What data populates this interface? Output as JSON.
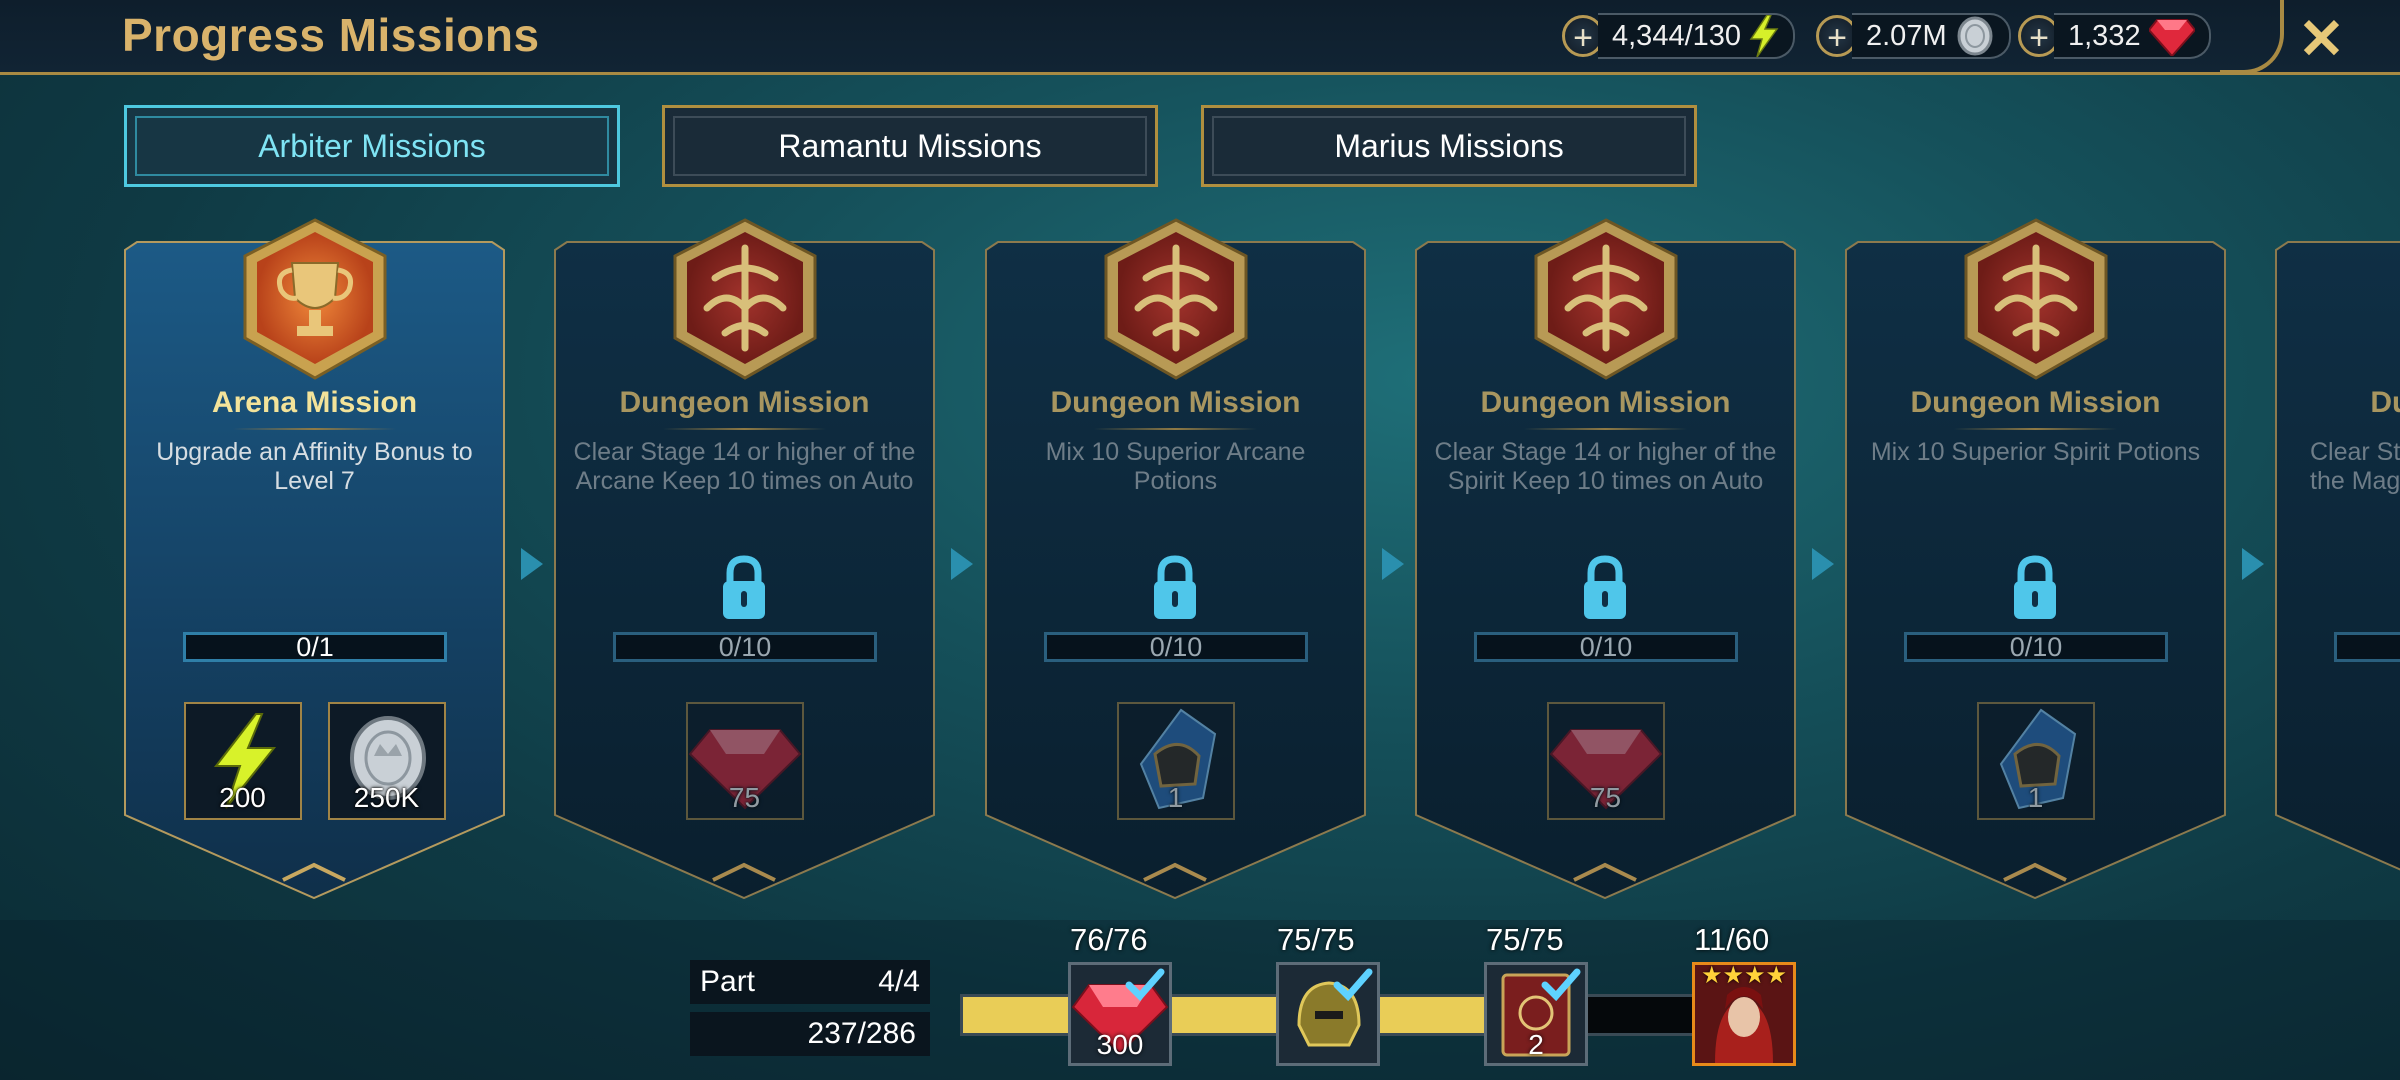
{
  "header": {
    "title": "Progress Missions",
    "close_label": "✕"
  },
  "resources": [
    {
      "value": "4,344/130",
      "icon": "energy-icon"
    },
    {
      "value": "2.07M",
      "icon": "silver-coin-icon"
    },
    {
      "value": "1,332",
      "icon": "ruby-gem-icon"
    }
  ],
  "tabs": [
    {
      "label": "Arbiter Missions",
      "active": true
    },
    {
      "label": "Ramantu Missions",
      "active": false
    },
    {
      "label": "Marius Missions",
      "active": false
    }
  ],
  "missions": [
    {
      "title": "Arena Mission",
      "desc": "Upgrade an Affinity Bonus to Level 7",
      "progress": "0/1",
      "locked": false,
      "rewards": [
        {
          "icon": "energy-icon",
          "amount": "200"
        },
        {
          "icon": "silver-coin-icon",
          "amount": "250K"
        }
      ]
    },
    {
      "title": "Dungeon Mission",
      "desc": "Clear Stage 14 or higher of the Arcane Keep 10 times on Auto",
      "progress": "0/10",
      "locked": true,
      "rewards": [
        {
          "icon": "ruby-gem-icon",
          "amount": "75"
        }
      ]
    },
    {
      "title": "Dungeon Mission",
      "desc": "Mix 10 Superior Arcane Potions",
      "progress": "0/10",
      "locked": true,
      "rewards": [
        {
          "icon": "helmet-shard-icon",
          "amount": "1"
        }
      ]
    },
    {
      "title": "Dungeon Mission",
      "desc": "Clear Stage 14 or higher of the Spirit Keep 10 times on Auto",
      "progress": "0/10",
      "locked": true,
      "rewards": [
        {
          "icon": "ruby-gem-icon",
          "amount": "75"
        }
      ]
    },
    {
      "title": "Dungeon Mission",
      "desc": "Mix 10 Superior Spirit Potions",
      "progress": "0/10",
      "locked": true,
      "rewards": [
        {
          "icon": "helmet-shard-icon",
          "amount": "1"
        }
      ]
    },
    {
      "title": "Dun",
      "desc": "Clear St the Mag",
      "progress": "",
      "locked": true,
      "rewards": []
    }
  ],
  "part": {
    "label": "Part",
    "value": "4/4",
    "points": "237/286"
  },
  "milestones": [
    {
      "label": "76/76",
      "amount": "300",
      "icon": "ruby-gem-icon",
      "claimed": true
    },
    {
      "label": "75/75",
      "amount": "",
      "icon": "helmet-icon",
      "claimed": true
    },
    {
      "label": "75/75",
      "amount": "2",
      "icon": "tome-icon",
      "claimed": true
    },
    {
      "label": "11/60",
      "amount": "",
      "icon": "champion-portrait-icon",
      "claimed": false,
      "stars": "★★★★"
    }
  ],
  "track_progress": 0.83,
  "colors": {
    "accent_gold": "#d9b36b",
    "active_tab": "#4ec9e0",
    "progress_fill": "#e9cd57"
  }
}
